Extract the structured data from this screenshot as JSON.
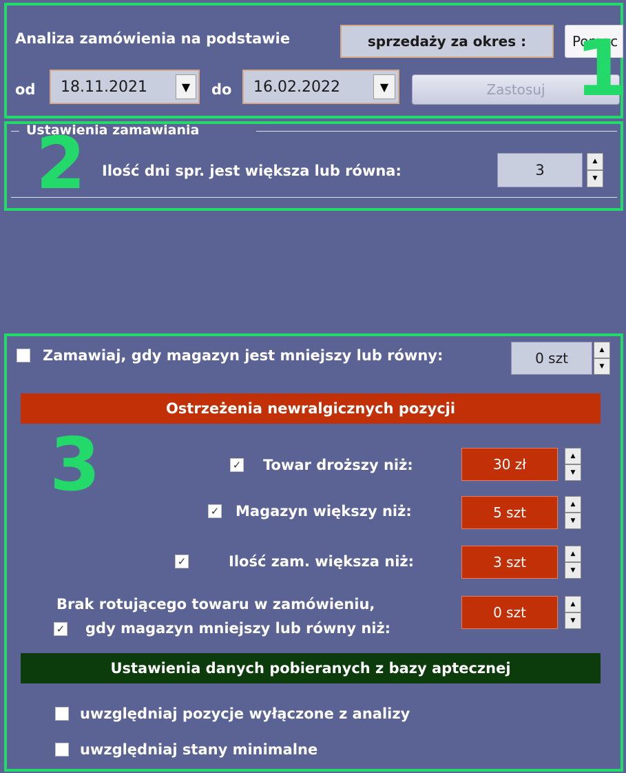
{
  "section1": {
    "number": "1",
    "analysis_label": "Analiza zamówienia na podstawie",
    "period_label": "sprzedaży za okres :",
    "help_button": "Pomoc",
    "from_label": "od",
    "from_date": "18.11.2021",
    "to_label": "do",
    "to_date": "16.02.2022",
    "apply_button": "Zastosuj"
  },
  "section2": {
    "number": "2",
    "group_title": "Ustawienia zamawiania",
    "days_label": "Ilość dni spr. jest większa lub równa:",
    "days_value": "3"
  },
  "section3": {
    "number": "3",
    "order_when_label": "Zamawiaj, gdy magazyn jest mniejszy lub równy:",
    "order_when_value": "0 szt",
    "order_when_checked": false,
    "warnings_header": "Ostrzeżenia newralgicznych pozycji",
    "warnings": [
      {
        "label": "Towar droższy niż:",
        "value": "30 zł",
        "checked": true
      },
      {
        "label": "Magazyn większy niż:",
        "value": "5 szt",
        "checked": true
      },
      {
        "label": "Ilość zam. większa niż:",
        "value": "3 szt",
        "checked": true
      },
      {
        "label_line1": "Brak rotującego towaru w zamówieniu,",
        "label_line2": "gdy magazyn mniejszy lub równy niż:",
        "value": "0 szt",
        "checked": true
      }
    ],
    "db_header": "Ustawienia danych pobieranych  z bazy aptecznej",
    "db_options": [
      {
        "label": "uwzględniaj pozycje wyłączone z analizy",
        "checked": false
      },
      {
        "label": "uwzględniaj stany minimalne",
        "checked": false
      }
    ]
  },
  "colors": {
    "background": "#5b6294",
    "frame": "#22d96a",
    "warning_header": "#c23008",
    "db_header": "#0c3b0c"
  },
  "icons": {
    "dropdown": "triangle-down",
    "spin_up": "triangle-up",
    "spin_down": "triangle-down",
    "check": "check-mark"
  }
}
